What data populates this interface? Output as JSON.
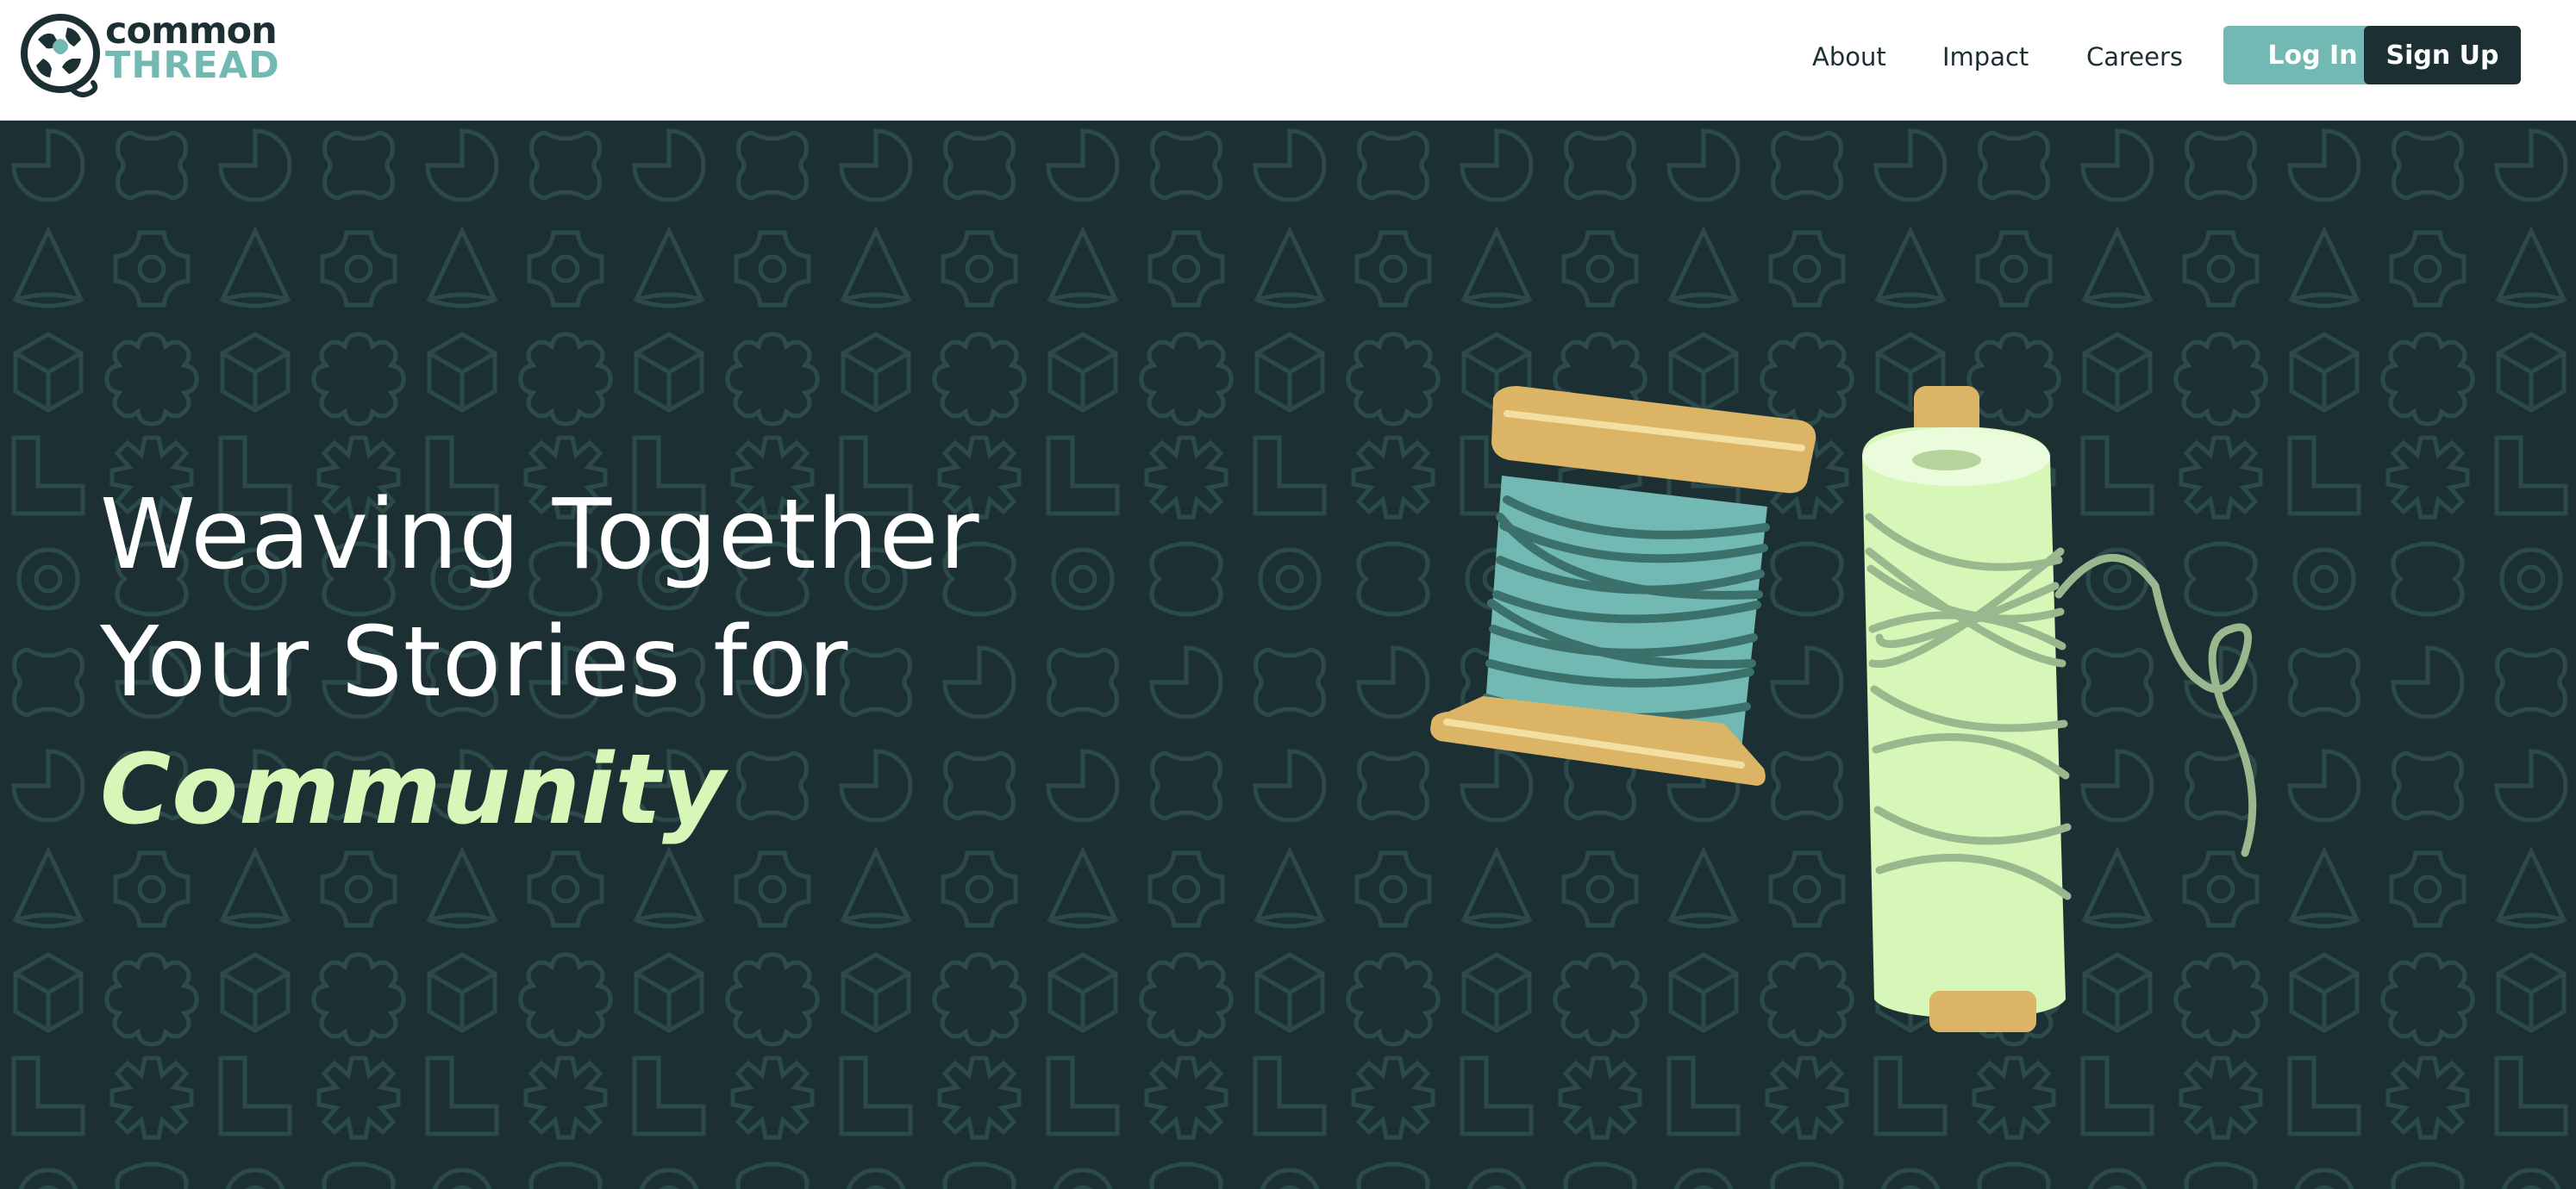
{
  "brand": {
    "name_line1": "common",
    "name_line2": "THREAD"
  },
  "nav": {
    "links": [
      {
        "label": "About"
      },
      {
        "label": "Impact"
      },
      {
        "label": "Careers"
      }
    ],
    "login_label": "Log In",
    "signup_label": "Sign Up"
  },
  "hero": {
    "headline_line1": "Weaving Together",
    "headline_line2": "Your Stories for",
    "headline_accent": "Community"
  },
  "colors": {
    "brand_dark": "#1c3034",
    "brand_teal": "#71b9b2",
    "accent_mint": "#d6f7b8",
    "spool_wood": "#dbb565",
    "pattern_line": "#2c4a49"
  },
  "icons": {
    "logo": "common-thread-hands-logo-icon",
    "illustration": "thread-spools-illustration"
  }
}
